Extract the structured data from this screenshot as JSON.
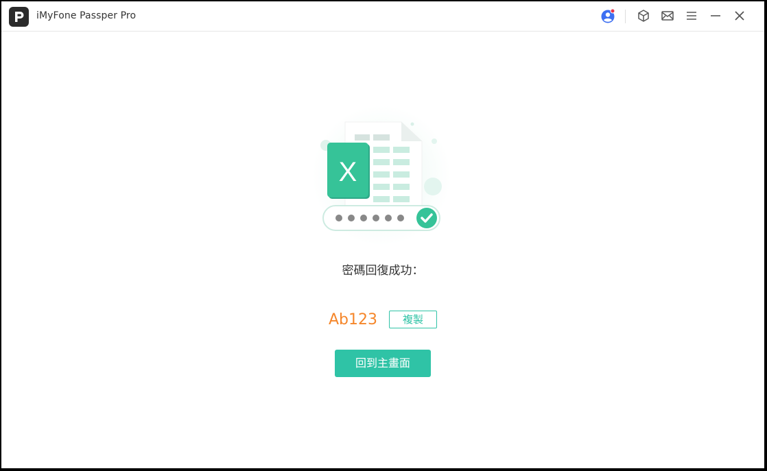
{
  "window": {
    "title": "iMyFone Passper Pro"
  },
  "titlebar": {
    "icons": [
      "account-icon",
      "product-box-icon",
      "mail-icon",
      "menu-icon",
      "minimize-icon",
      "close-icon"
    ],
    "notification_dot_color": "#e8334a"
  },
  "main": {
    "success_message": "密碼回復成功：",
    "password": "Ab123",
    "copy_label": "複製",
    "home_label": "回到主畫面"
  },
  "colors": {
    "accent": "#2fc3a6",
    "password": "#f5862a",
    "excel_green": "#31b98f"
  }
}
